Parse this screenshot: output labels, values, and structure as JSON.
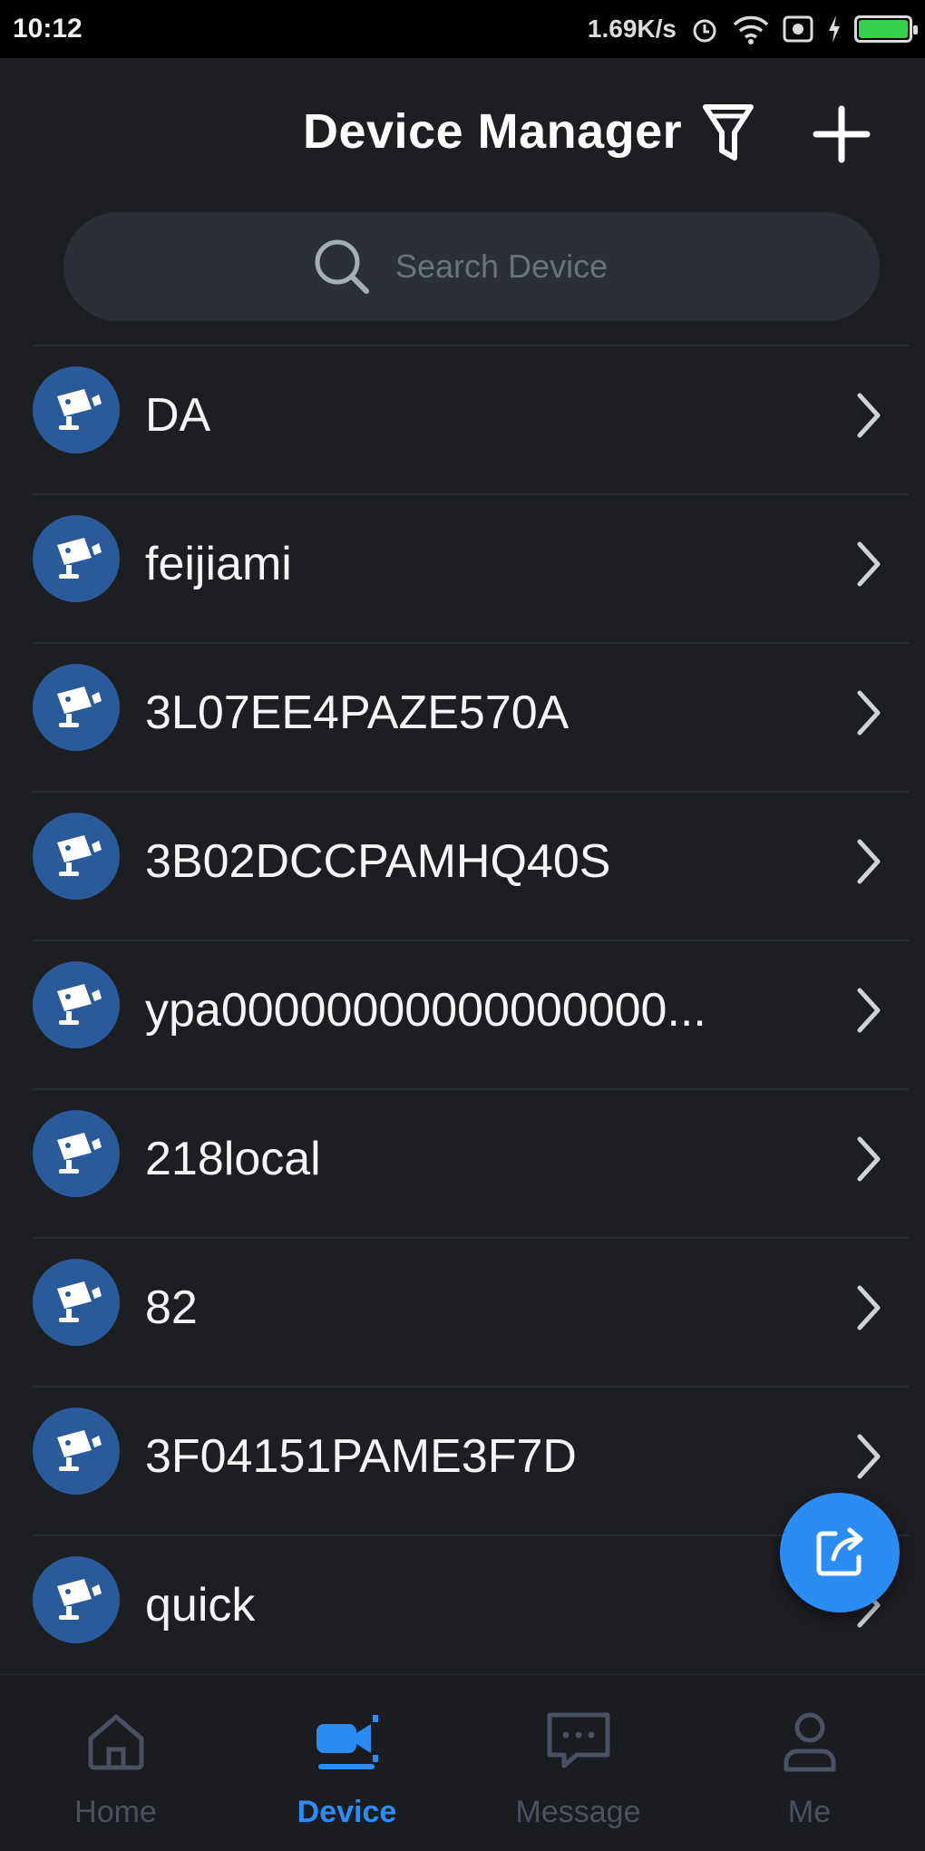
{
  "status_bar": {
    "time": "10:12",
    "net_speed": "1.69K/s",
    "battery_level": 1.0,
    "battery_color": "#35d14b"
  },
  "header": {
    "title": "Device Manager",
    "filter_icon": "filter-icon",
    "add_icon": "plus-icon"
  },
  "search": {
    "placeholder": "Search Device",
    "icon": "search-icon"
  },
  "devices": [
    {
      "name": "DA"
    },
    {
      "name": "feijiami"
    },
    {
      "name": "3L07EE4PAZE570A"
    },
    {
      "name": "3B02DCCPAMHQ40S"
    },
    {
      "name": "ypa00000000000000000..."
    },
    {
      "name": "218local"
    },
    {
      "name": "82"
    },
    {
      "name": "3F04151PAME3F7D"
    },
    {
      "name": "quick"
    }
  ],
  "fab": {
    "icon": "share-icon"
  },
  "tabs": [
    {
      "label": "Home",
      "icon": "home-icon",
      "active": false
    },
    {
      "label": "Device",
      "icon": "camera-icon",
      "active": true
    },
    {
      "label": "Message",
      "icon": "message-icon",
      "active": false
    },
    {
      "label": "Me",
      "icon": "user-icon",
      "active": false
    }
  ],
  "colors": {
    "background": "#1c1e22",
    "accent": "#2b8df3",
    "avatar": "#2a5a99",
    "inactive_tab": "#4a5160"
  }
}
